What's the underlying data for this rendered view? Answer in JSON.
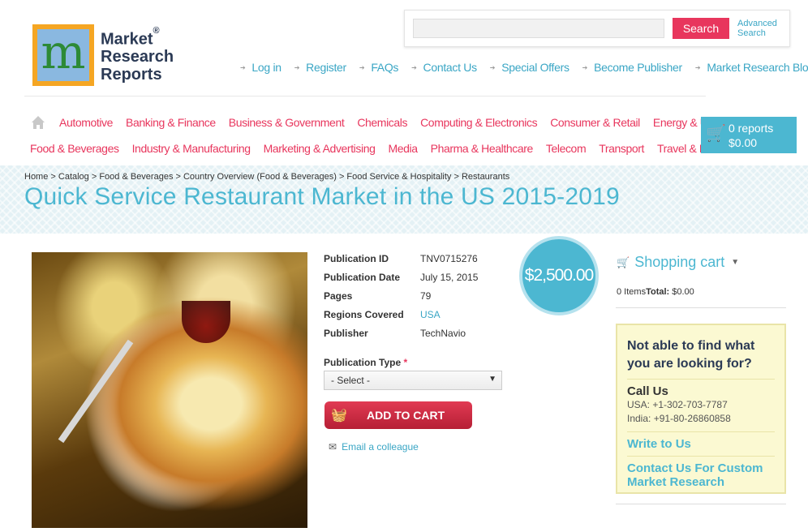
{
  "brand": {
    "line1": "Market",
    "line2": "Research",
    "line3": "Reports",
    "reg": "®",
    "mark": "m"
  },
  "search": {
    "placeholder": "",
    "button_label": "Search",
    "advanced_line1": "Advanced",
    "advanced_line2": "Search"
  },
  "top_links": [
    "Log in",
    "Register",
    "FAQs",
    "Contact Us",
    "Special Offers",
    "Become Publisher",
    "Market Research Blog"
  ],
  "categories_row1": [
    "Automotive",
    "Banking & Finance",
    "Business & Government",
    "Chemicals",
    "Computing & Electronics",
    "Consumer & Retail",
    "Energy & Utilities"
  ],
  "categories_row2": [
    "Food & Beverages",
    "Industry & Manufacturing",
    "Marketing & Advertising",
    "Media",
    "Pharma & Healthcare",
    "Telecom",
    "Transport",
    "Travel & Leisure"
  ],
  "cart_widget": {
    "reports": "0 reports",
    "total": "$0.00"
  },
  "breadcrumb": "Home > Catalog > Food & Beverages > Country Overview (Food & Beverages) > Food Service & Hospitality > Restaurants",
  "page_title": "Quick Service Restaurant Market in the US 2015-2019",
  "details": {
    "publication_id_label": "Publication ID",
    "publication_id": "TNV0715276",
    "publication_date_label": "Publication Date",
    "publication_date": "July 15, 2015",
    "pages_label": "Pages",
    "pages": "79",
    "regions_label": "Regions Covered",
    "regions": "USA",
    "publisher_label": "Publisher",
    "publisher": "TechNavio"
  },
  "price": "$2,500.00",
  "publication_type": {
    "label": "Publication Type",
    "required": "*",
    "selected": "- Select -"
  },
  "add_to_cart_label": "ADD TO CART",
  "email_colleague_label": "Email a colleague",
  "shopping_cart": {
    "title": "Shopping cart",
    "items": "0 Items",
    "total_label": "Total:",
    "total_value": " $0.00"
  },
  "help": {
    "question": "Not able to find what you are looking for?",
    "call_title": "Call Us",
    "usa": "USA: +1-302-703-7787",
    "india": "India: +91-80-26860858",
    "write_link": "Write to Us",
    "custom_link": "Contact Us For Custom Market Research"
  },
  "colors": {
    "accent_blue": "#4cb7d1",
    "accent_red": "#e8365d",
    "help_bg": "#fbf9d2"
  }
}
